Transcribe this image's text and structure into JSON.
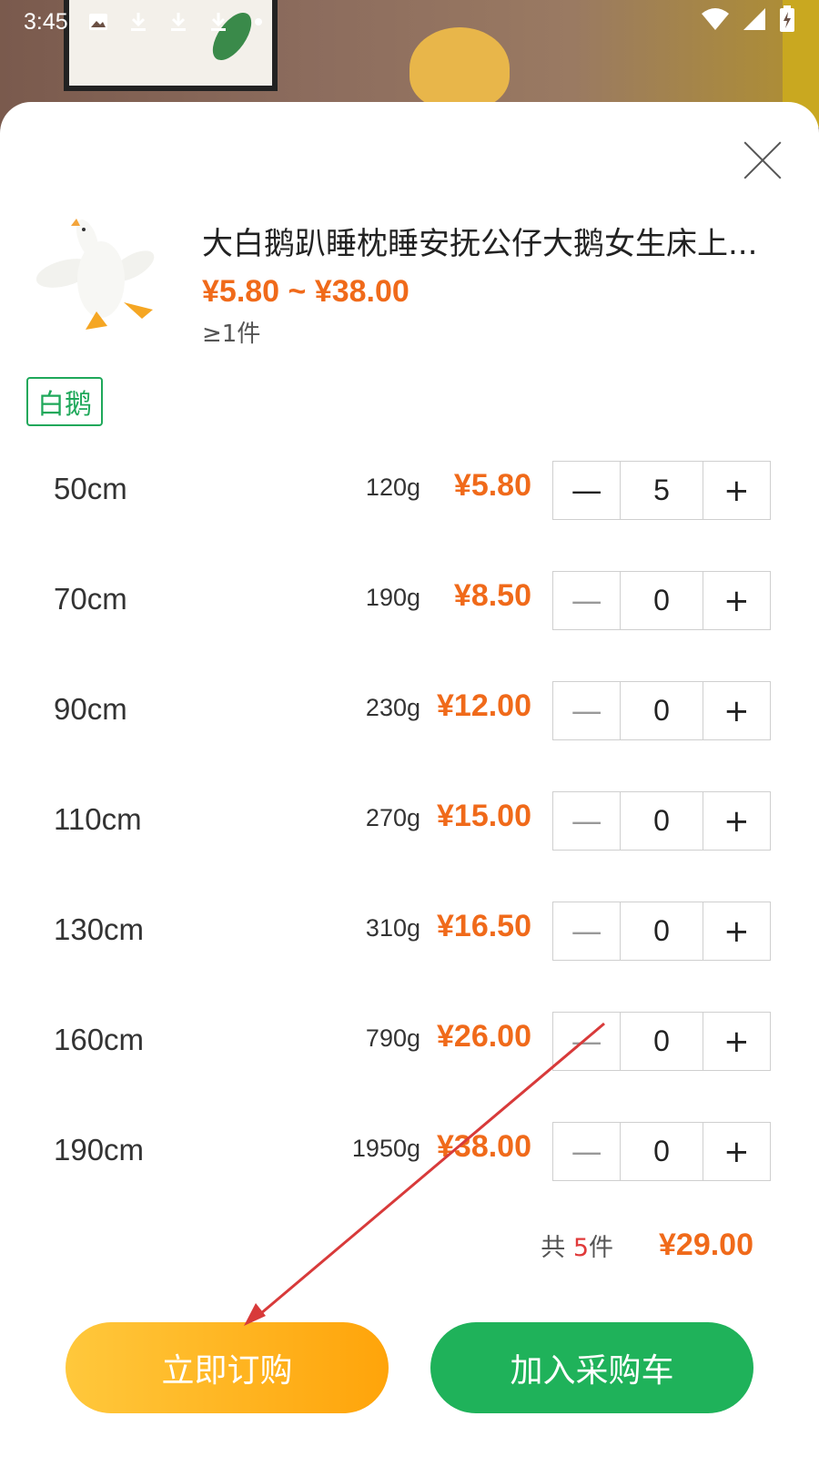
{
  "status_bar": {
    "time": "3:45",
    "notification_icons": [
      "image-icon",
      "download-icon",
      "download-icon",
      "download-icon",
      "dot-icon"
    ],
    "system_icons": [
      "wifi-icon",
      "signal-icon",
      "battery-icon"
    ]
  },
  "product": {
    "title": "大白鹅趴睡枕睡安抚公仔大鹅女生床上...",
    "price_range": "¥5.80 ~ ¥38.00",
    "min_order": "≥1件"
  },
  "variant_tag": "白鹅",
  "rows": [
    {
      "size": "50cm",
      "weight": "120g",
      "price": "¥5.80",
      "qty": "5"
    },
    {
      "size": "70cm",
      "weight": "190g",
      "price": "¥8.50",
      "qty": "0"
    },
    {
      "size": "90cm",
      "weight": "230g",
      "price": "¥12.00",
      "qty": "0"
    },
    {
      "size": "110cm",
      "weight": "270g",
      "price": "¥15.00",
      "qty": "0"
    },
    {
      "size": "130cm",
      "weight": "310g",
      "price": "¥16.50",
      "qty": "0"
    },
    {
      "size": "160cm",
      "weight": "790g",
      "price": "¥26.00",
      "qty": "0"
    },
    {
      "size": "190cm",
      "weight": "1950g",
      "price": "¥38.00",
      "qty": "0"
    }
  ],
  "stepper": {
    "minus": "—",
    "plus": "+"
  },
  "summary": {
    "prefix": "共 ",
    "count": "5",
    "suffix": "件",
    "amount": "¥29.00"
  },
  "buttons": {
    "order_now": "立即订购",
    "add_to_cart": "加入采购车"
  },
  "colors": {
    "price": "#f06a1a",
    "green": "#1fb25a",
    "orange_start": "#ffc83c",
    "orange_end": "#ffa40a",
    "annotation_arrow": "#d83a3a"
  }
}
